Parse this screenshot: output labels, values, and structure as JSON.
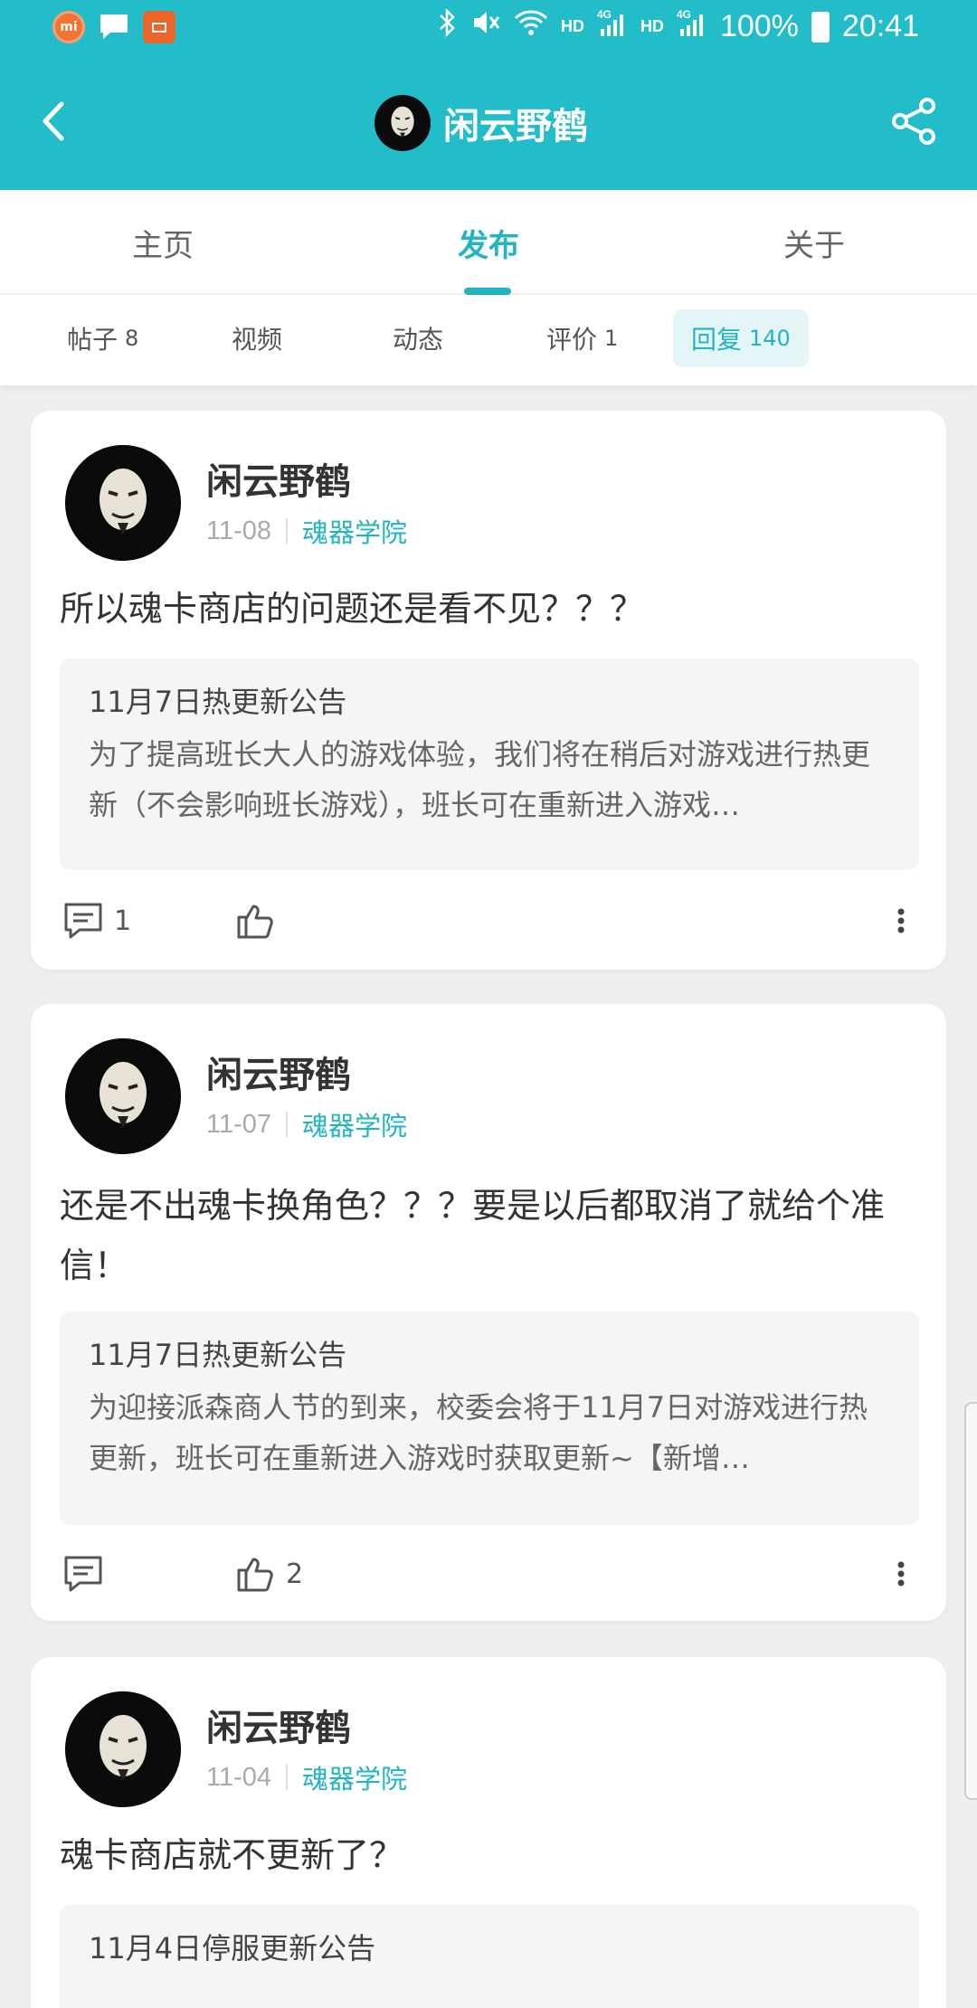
{
  "status_bar": {
    "network_left": "HD",
    "signal1": "4G",
    "network_right": "HD",
    "signal2": "4G",
    "battery": "100%",
    "time": "20:41",
    "app_icons": [
      "mi-icon",
      "message-icon",
      "app-square-icon"
    ]
  },
  "header": {
    "title": "闲云野鹤",
    "back_icon": "chevron-left-icon",
    "share_icon": "share-icon"
  },
  "tabs": [
    {
      "label": "主页",
      "active": false
    },
    {
      "label": "发布",
      "active": true
    },
    {
      "label": "关于",
      "active": false
    }
  ],
  "subtabs": [
    {
      "label": "帖子",
      "count": "8"
    },
    {
      "label": "视频",
      "count": ""
    },
    {
      "label": "动态",
      "count": ""
    },
    {
      "label": "评价",
      "count": "1"
    },
    {
      "label": "回复",
      "count": "140",
      "active": true
    }
  ],
  "posts": [
    {
      "author": "闲云野鹤",
      "date": "11-08",
      "forum": "魂器学院",
      "text": "所以魂卡商店的问题还是看不见？？？",
      "quote_title": "11月7日热更新公告",
      "quote_body": "为了提高班长大人的游戏体验，我们将在稍后对游戏进行热更新（不会影响班长游戏），班长可在重新进入游戏…",
      "comments": "1",
      "likes": ""
    },
    {
      "author": "闲云野鹤",
      "date": "11-07",
      "forum": "魂器学院",
      "text": "还是不出魂卡换角色？？？要是以后都取消了就给个准信！",
      "quote_title": "11月7日热更新公告",
      "quote_body": "为迎接派森商人节的到来，校委会将于11月7日对游戏进行热更新，班长可在重新进入游戏时获取更新~【新增…",
      "comments": "",
      "likes": "2"
    },
    {
      "author": "闲云野鹤",
      "date": "11-04",
      "forum": "魂器学院",
      "text": "魂卡商店就不更新了？",
      "quote_title": "11月4日停服更新公告",
      "quote_body": "",
      "comments": "",
      "likes": ""
    }
  ],
  "colors": {
    "accent": "#23bcc9",
    "accent_text": "#23b4c1",
    "background": "#efefef"
  }
}
